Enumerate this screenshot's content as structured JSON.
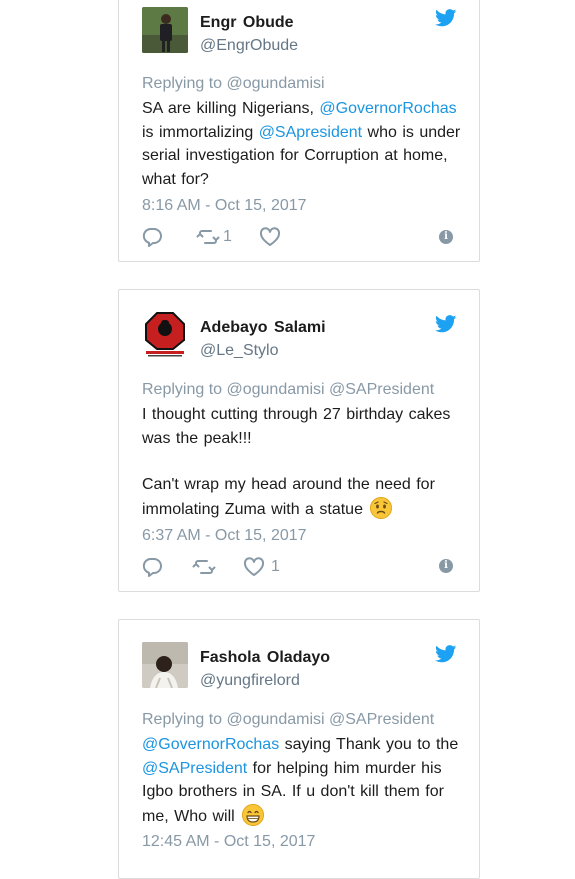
{
  "tweets": [
    {
      "name": "Engr Obude",
      "handle": "@EngrObude",
      "replying": "Replying to @ogundamisi",
      "text_parts": [
        {
          "t": "SA are killing Nigerians, ",
          "m": false
        },
        {
          "t": "@GovernorRochas",
          "m": true
        },
        {
          "t": " is immortalizing ",
          "m": false
        },
        {
          "t": "@SApresident",
          "m": true
        },
        {
          "t": " who is under serial investigation for Corruption at home, what for?",
          "m": false
        }
      ],
      "time": "8:16 AM - Oct 15, 2017",
      "retweets": "1",
      "likes": ""
    },
    {
      "name": "Adebayo Salami",
      "handle": "@Le_Stylo",
      "replying": "Replying to @ogundamisi @SAPresident",
      "text_line1": "I thought cutting through 27 birthday cakes was the peak!!!",
      "text_line2": "Can't wrap my head around the need for immolating Zuma with a statue",
      "emoji": "worried-face",
      "time": "6:37 AM - Oct 15, 2017",
      "retweets": "",
      "likes": "1"
    },
    {
      "name": "Fashola Oladayo",
      "handle": "@yungfirelord",
      "replying": "Replying to @ogundamisi @SAPresident",
      "text_parts": [
        {
          "t": "@GovernorRochas",
          "m": true
        },
        {
          "t": " saying Thank you to the ",
          "m": false
        },
        {
          "t": "@SAPresident",
          "m": true
        },
        {
          "t": " for helping him murder his Igbo brothers in SA. If u don't kill them for me, Who will ",
          "m": false
        }
      ],
      "emoji": "grinning-face",
      "time": "12:45 AM - Oct 15, 2017"
    }
  ],
  "colors": {
    "accent": "#1b95e0",
    "twitter_blue": "#1da1f2",
    "muted": "#8899a6"
  }
}
